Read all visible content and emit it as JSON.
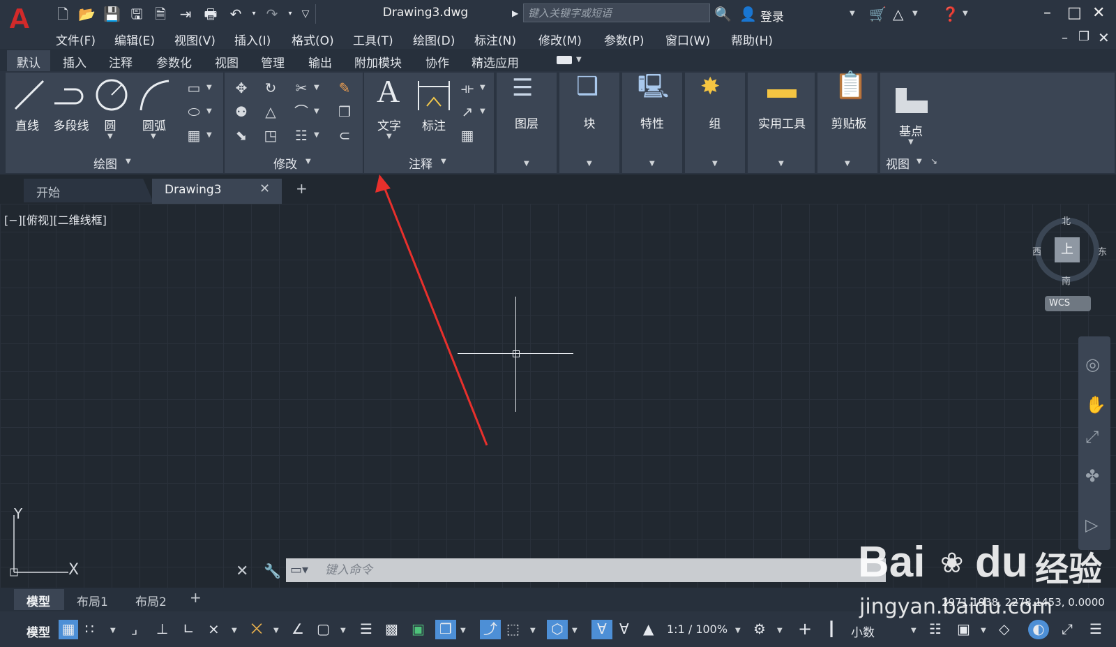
{
  "titlebar": {
    "logo": "A",
    "doc_title": "Drawing3.dwg",
    "search_placeholder": "键入关键字或短语",
    "login": "登录",
    "icons": [
      "new-icon",
      "open-icon",
      "save-icon",
      "save-as-icon",
      "publish-icon",
      "plot-icon",
      "print-icon",
      "undo-icon",
      "redo-icon",
      "customize-icon"
    ]
  },
  "menu": [
    "文件(F)",
    "编辑(E)",
    "视图(V)",
    "插入(I)",
    "格式(O)",
    "工具(T)",
    "绘图(D)",
    "标注(N)",
    "修改(M)",
    "参数(P)",
    "窗口(W)",
    "帮助(H)"
  ],
  "ribbon_tabs": [
    "默认",
    "插入",
    "注释",
    "参数化",
    "视图",
    "管理",
    "输出",
    "附加模块",
    "协作",
    "精选应用"
  ],
  "ribbon": {
    "draw": {
      "line": "直线",
      "polyline": "多段线",
      "circle": "圆",
      "arc": "圆弧",
      "panel": "绘图"
    },
    "modify": {
      "panel": "修改"
    },
    "annotation": {
      "text": "文字",
      "dimension": "标注",
      "panel": "注释"
    },
    "layers": "图层",
    "block": "块",
    "properties": "特性",
    "group": "组",
    "utilities": "实用工具",
    "clipboard": "剪贴板",
    "view": {
      "basepoint": "基点",
      "panel": "视图"
    }
  },
  "doc_tabs": {
    "start": "开始",
    "drawing": "Drawing3",
    "add": "+"
  },
  "viewport_label": "[−][俯视][二维线框]",
  "viewcube": {
    "north": "北",
    "south": "南",
    "east": "东",
    "west": "西",
    "top": "上",
    "wcs": "WCS"
  },
  "ucs": {
    "x": "X",
    "y": "Y"
  },
  "command_placeholder": "键入命令",
  "layout_tabs": [
    "模型",
    "布局1",
    "布局2"
  ],
  "status": {
    "model": "模型",
    "scale": "1:1 / 100%",
    "units": "小数",
    "coords": "2971.1938, 2278.1453, 0.0000"
  },
  "watermark": {
    "brand": "Bai",
    "brand2": "du",
    "jingyan": "经验",
    "url": "jingyan.baidu.com"
  },
  "colors": {
    "accent": "#d22a2a",
    "arrow": "#e8302c",
    "active_status": "#4d8fd6"
  }
}
